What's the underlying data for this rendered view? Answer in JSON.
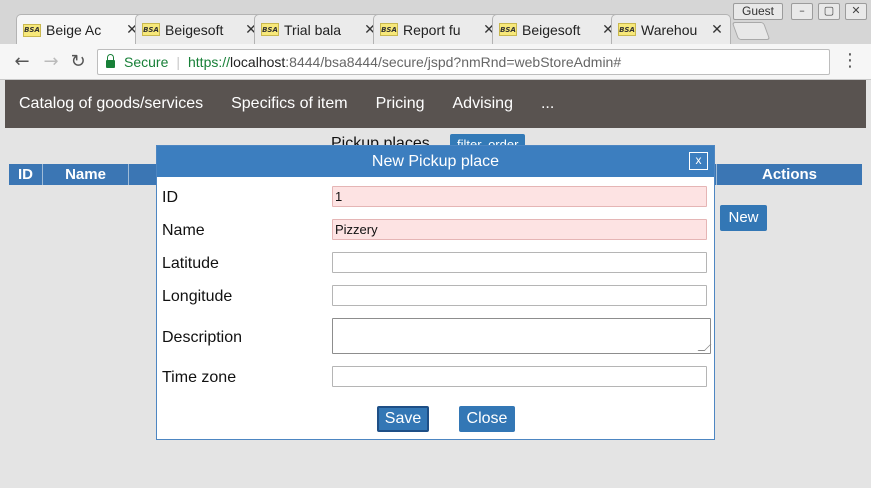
{
  "browser": {
    "tabs": [
      {
        "label": "Beige Ac",
        "favicon": "BSA",
        "active": true
      },
      {
        "label": "Beigesoft",
        "favicon": "BSA",
        "active": false
      },
      {
        "label": "Trial bala",
        "favicon": "BSA",
        "active": false
      },
      {
        "label": "Report fu",
        "favicon": "BSA",
        "active": false
      },
      {
        "label": "Beigesoft",
        "favicon": "BSA",
        "active": false
      },
      {
        "label": "Warehou",
        "favicon": "BSA",
        "active": false
      }
    ],
    "tab_close": "✕",
    "profile": "Guest",
    "window_buttons": {
      "minimize": "–",
      "maximize": "▢",
      "close": "✕"
    },
    "nav": {
      "back": "←",
      "forward": "→",
      "reload": "↻",
      "menu": "⋮"
    },
    "address": {
      "secure_label": "Secure",
      "separator": "|",
      "scheme": "https://",
      "host": "localhost",
      "rest": ":8444/bsa8444/secure/jspd?nmRnd=webStoreAdmin#"
    }
  },
  "app_nav": {
    "items": [
      "Catalog of goods/services",
      "Specifics of item",
      "Pricing",
      "Advising",
      "..."
    ]
  },
  "list": {
    "title": "Pickup places",
    "filter_order_label": "filter, order",
    "columns": [
      "ID",
      "Name",
      "Actions"
    ],
    "new_button": "New"
  },
  "dialog": {
    "title": "New Pickup place",
    "close_label": "x",
    "fields": {
      "id": {
        "label": "ID",
        "value": "1"
      },
      "name": {
        "label": "Name",
        "value": "Pizzery"
      },
      "latitude": {
        "label": "Latitude",
        "value": ""
      },
      "longitude": {
        "label": "Longitude",
        "value": ""
      },
      "description": {
        "label": "Description",
        "value": ""
      },
      "time_zone": {
        "label": "Time zone",
        "value": ""
      }
    },
    "save_label": "Save",
    "close_button_label": "Close"
  },
  "colors": {
    "accent": "#3377b5",
    "nav_bg": "#595350",
    "required_bg": "#fde3e3"
  }
}
